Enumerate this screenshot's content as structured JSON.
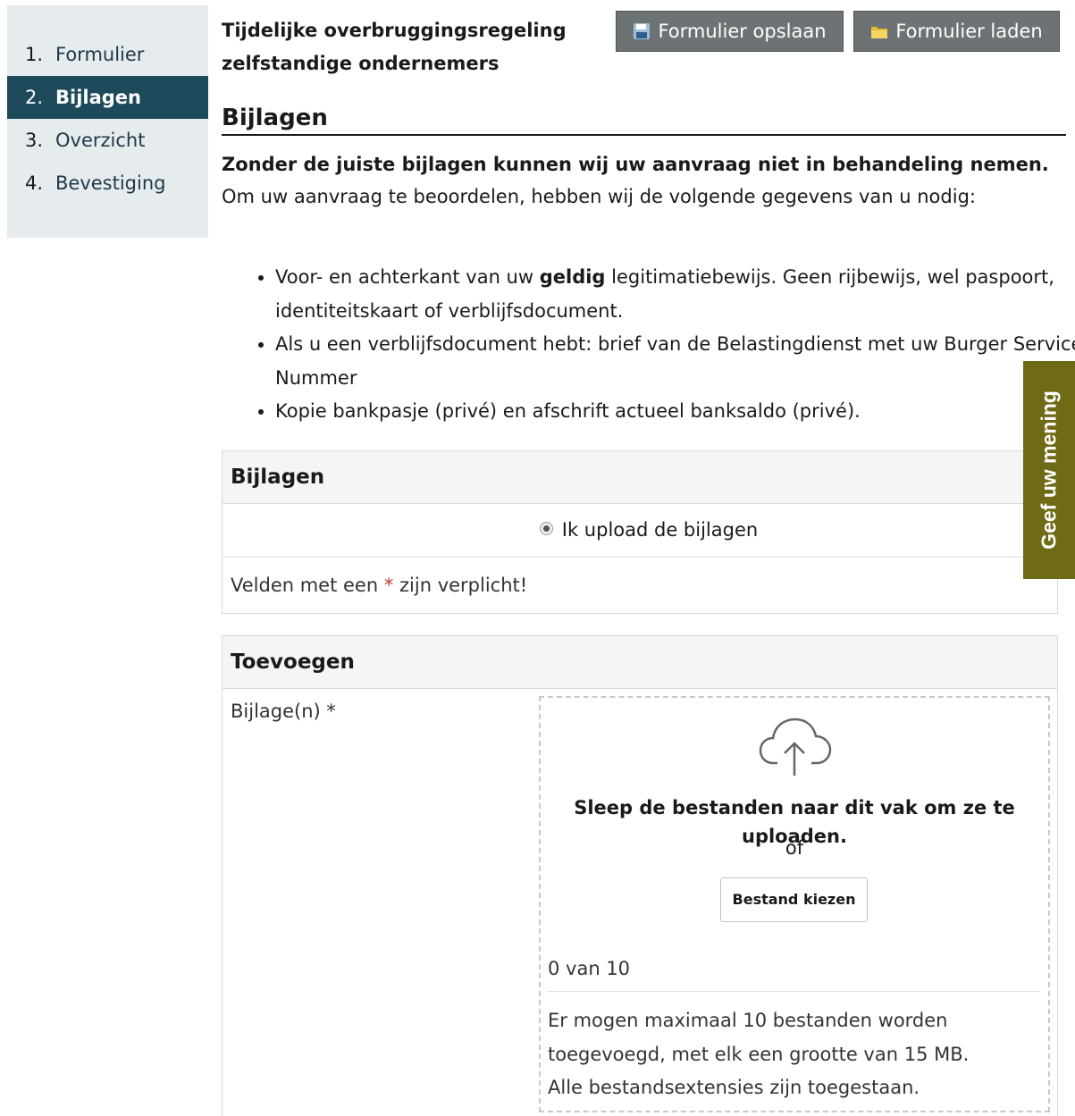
{
  "steps": [
    {
      "num": "1.",
      "label": "Formulier"
    },
    {
      "num": "2.",
      "label": "Bijlagen"
    },
    {
      "num": "3.",
      "label": "Overzicht"
    },
    {
      "num": "4.",
      "label": "Bevestiging"
    }
  ],
  "header": {
    "title_line1": "Tijdelijke overbruggingsregeling",
    "title_line2": "zelfstandige ondernemers",
    "save_label": "Formulier opslaan",
    "load_label": "Formulier laden"
  },
  "section": {
    "heading": "Bijlagen",
    "lead": "Zonder de juiste bijlagen kunnen wij uw aanvraag niet in behandeling nemen.",
    "intro": "Om uw aanvraag te beoordelen, hebben wij de volgende gegevens van u nodig:"
  },
  "requirements": {
    "item1_before": "Voor- en achterkant van uw ",
    "item1_bold": "geldig",
    "item1_after": " legitimatiebewijs. Geen rijbewijs, wel paspoort, identiteitskaart of verblijfsdocument.",
    "item2": "Als u een verblijfsdocument hebt: brief van de Belastingdienst met uw Burger Service Nummer",
    "item3": "Kopie bankpasje (privé) en afschrift actueel banksaldo (privé)."
  },
  "bijlagen_panel": {
    "title": "Bijlagen",
    "option_label": "Ik upload de bijlagen",
    "required_before": "Velden met een ",
    "required_star": "*",
    "required_after": " zijn verplicht!"
  },
  "toevoegen_panel": {
    "title": "Toevoegen",
    "field_label": "Bijlage(n) *",
    "drop_text": "Sleep de bestanden naar dit vak om ze te uploaden.",
    "or_text": "of",
    "choose_button": "Bestand kiezen",
    "file_count": "0 van 10",
    "info_line1": "Er mogen maximaal 10 bestanden worden",
    "info_line2": "toegevoegd, met elk een grootte van 15 MB.",
    "info_line3": "Alle bestandsextensies zijn toegestaan."
  },
  "feedback_tab": "Geef uw mening",
  "colors": {
    "active_step": "#1c4a5a",
    "sidebar_bg": "#e6ebee",
    "button_gray": "#6d7275",
    "feedback_olive": "#6f6a16"
  },
  "icons": {
    "save": "floppy-disk-icon",
    "load": "folder-icon",
    "upload": "cloud-upload-icon",
    "radio": "radio-selected"
  }
}
